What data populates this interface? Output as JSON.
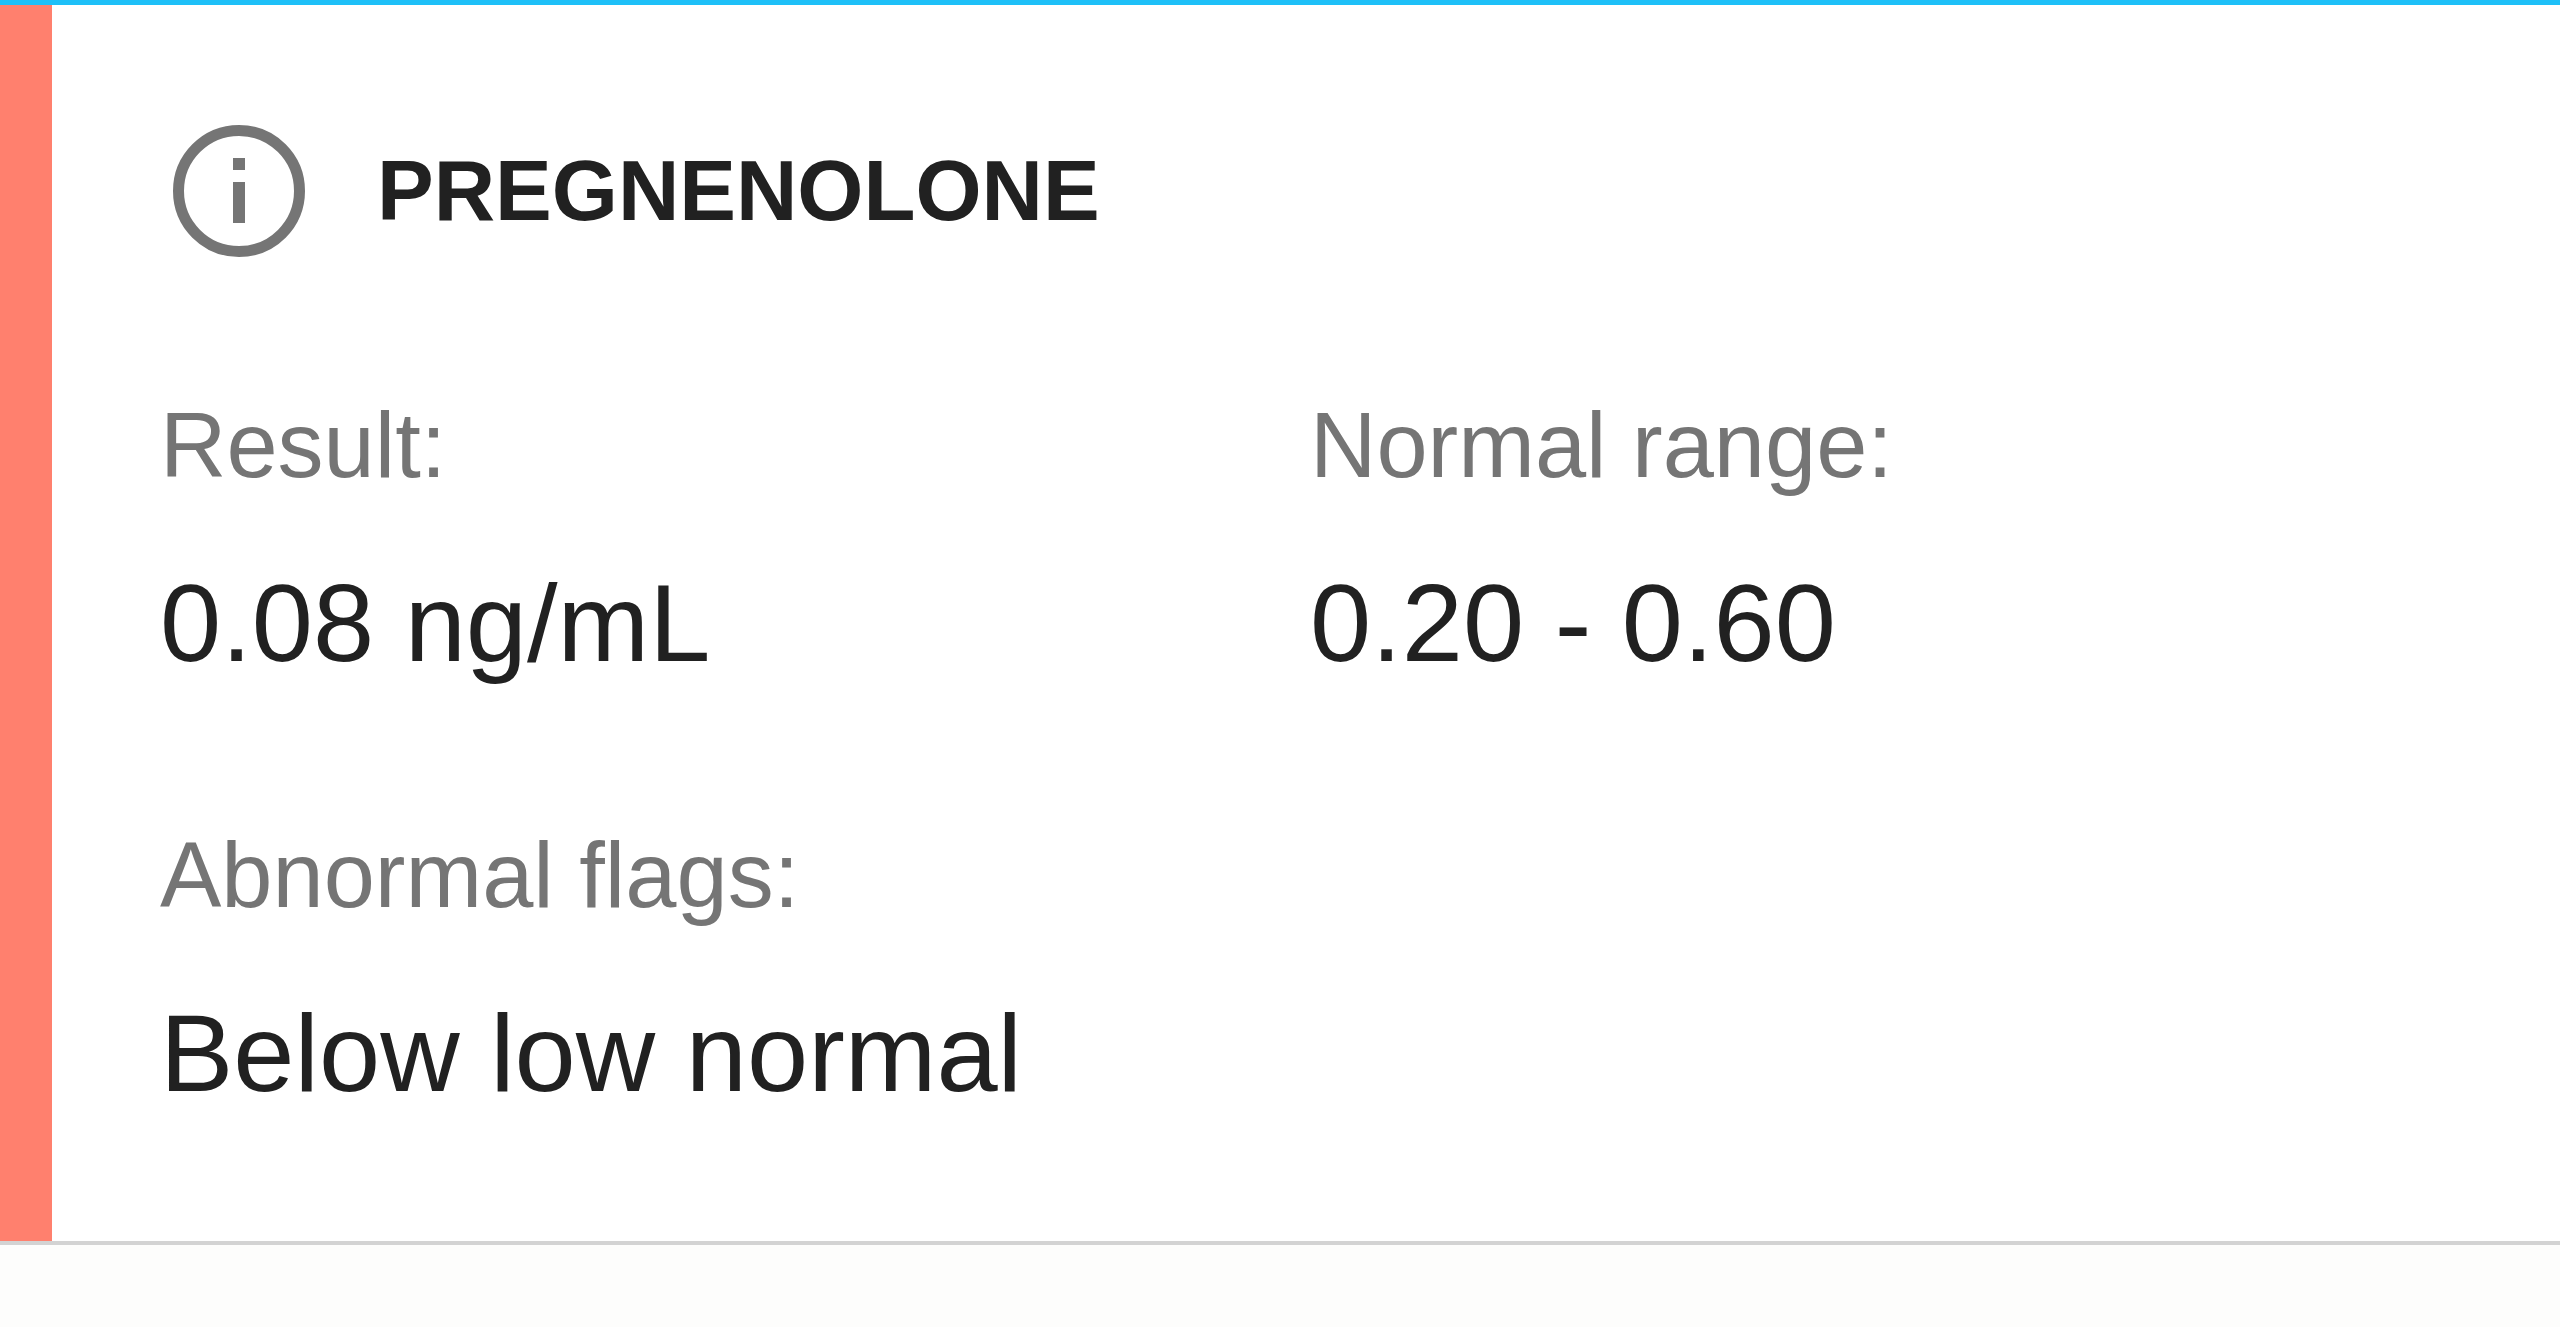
{
  "result": {
    "title": "PREGNENOLONE",
    "abnormal": true,
    "fields": [
      {
        "label": "Result:",
        "value": "0.08 ng/mL"
      },
      {
        "label": "Normal range:",
        "value": "0.20 - 0.60"
      },
      {
        "label": "Abnormal flags:",
        "value": "Below low normal"
      }
    ]
  }
}
